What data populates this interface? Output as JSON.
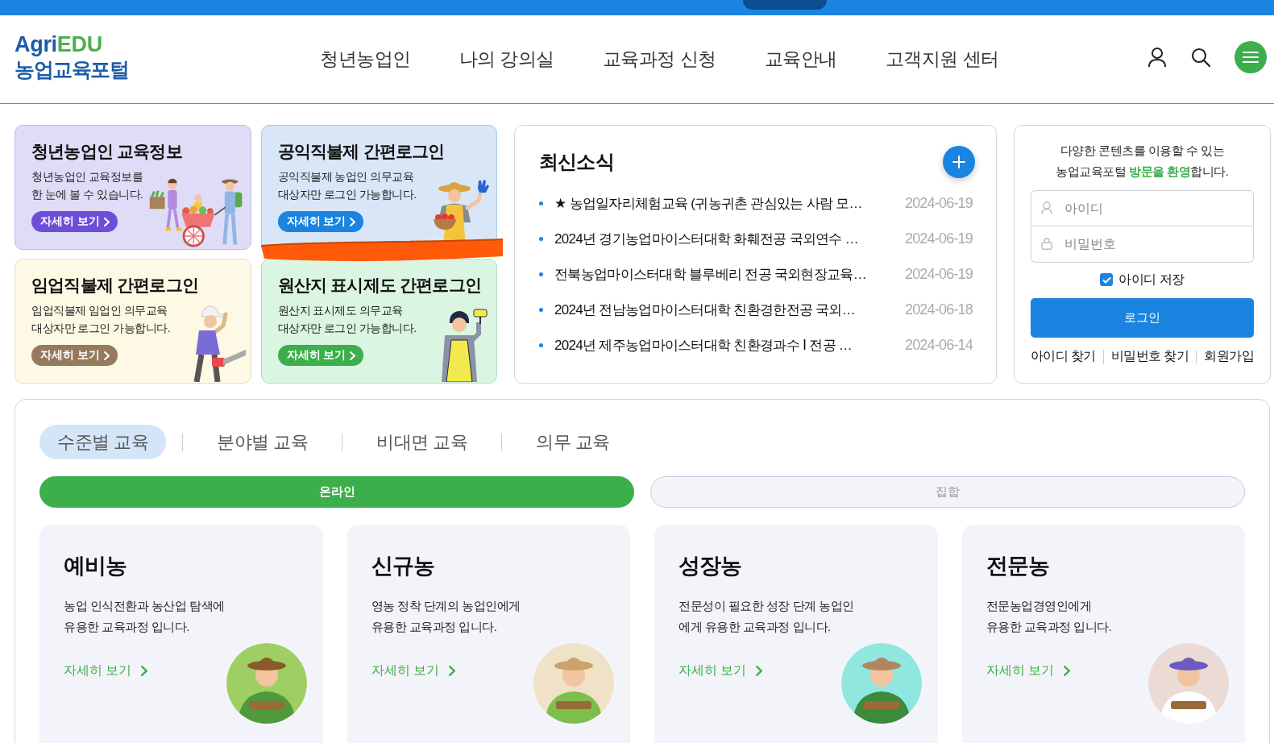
{
  "header": {
    "logo": {
      "wordmark": "Agri",
      "wordmark_accent": "EDU",
      "subtitle": "농업교육포털"
    },
    "nav": [
      "청년농업인",
      "나의 강의실",
      "교육과정 신청",
      "교육안내",
      "고객지원 센터"
    ]
  },
  "quick_cards": [
    {
      "kind": "cart",
      "title": "청년농업인 교육정보",
      "description": "청년농업인 교육정보를\n한 눈에 볼 수 있습니다.",
      "button": "자세히 보기"
    },
    {
      "kind": "waving",
      "title": "공익직불제 간편로그인",
      "description": "공익직불제 농업인 의무교육\n대상자만 로그인 가능합니다.",
      "button": "자세히 보기"
    },
    {
      "kind": "chainsaw",
      "title": "임업직불제 간편로그인",
      "description": "임업직불제 임업인 의무교육\n대상자만 로그인 가능합니다.",
      "button": "자세히 보기"
    },
    {
      "kind": "roller",
      "title": "원산지 표시제도 간편로그인",
      "description": "원산지 표시제도 의무교육\n대상자만 로그인 가능합니다.",
      "button": "자세히 보기"
    }
  ],
  "news": {
    "title": "최신소식",
    "items": [
      {
        "title": "★ 농업일자리체험교육 (귀농귀촌 관심있는 사람 모…",
        "date": "2024-06-19"
      },
      {
        "title": "2024년 경기농업마이스터대학 화훼전공 국외연수 …",
        "date": "2024-06-19"
      },
      {
        "title": "전북농업마이스터대학 블루베리 전공 국외현장교육…",
        "date": "2024-06-19"
      },
      {
        "title": "2024년 전남농업마이스터대학 친환경한전공 국외…",
        "date": "2024-06-18"
      },
      {
        "title": "2024년 제주농업마이스터대학 친환경과수 Ⅰ 전공 …",
        "date": "2024-06-14"
      }
    ]
  },
  "login": {
    "welcome": "다양한 콘텐츠를 이용할 수 있는\n농업교육포털 **방문을 환영**합니다.",
    "id_field": {
      "placeholder": "아이디"
    },
    "password_field": {
      "placeholder": "비밀번호"
    },
    "remember": {
      "label": "아이디 저장",
      "checked": true
    },
    "login_button": "로그인",
    "links": [
      "아이디 찾기",
      "비밀번호 찾기",
      "회원가입"
    ]
  },
  "courses": {
    "tabs": [
      {
        "label": "수준별 교육",
        "selected": true
      },
      {
        "label": "분야별 교육",
        "selected": false
      },
      {
        "label": "비대면 교육",
        "selected": false
      },
      {
        "label": "의무 교육",
        "selected": false
      }
    ],
    "modes": [
      {
        "label": "온라인",
        "selected": true
      },
      {
        "label": "집합",
        "selected": false
      }
    ],
    "cards": [
      {
        "title": "예비농",
        "description": "농업 인식전환과 농산업 탐색에\n유용한 교육과정 입니다.",
        "link": "자세히 보기"
      },
      {
        "title": "신규농",
        "description": "영농 정착 단계의 농업인에게\n유용한 교육과정 입니다.",
        "link": "자세히 보기"
      },
      {
        "title": "성장농",
        "description": "전문성이 필요한 성장 단계 농업인\n에게 유용한 교육과정 입니다.",
        "link": "자세히 보기"
      },
      {
        "title": "전문농",
        "description": "전문농업경영인에게\n유용한 교육과정 입니다.",
        "link": "자세히 보기"
      }
    ]
  }
}
